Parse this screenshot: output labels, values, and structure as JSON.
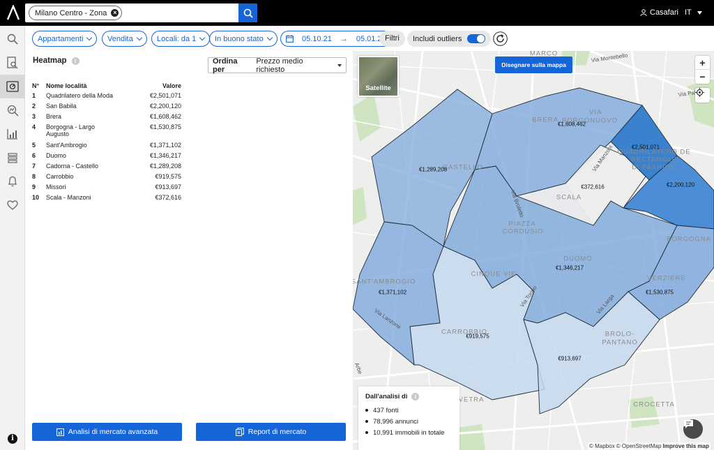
{
  "search": {
    "chip_label": "Milano Centro - Zona"
  },
  "header": {
    "user_name": "Casafari",
    "language": "IT"
  },
  "filters": {
    "property_type": "Appartamenti",
    "operation": "Vendita",
    "rooms": "Locali: da 1",
    "condition": "In buono stato",
    "date_from": "05.10.21",
    "date_arrow": "→",
    "date_to": "05.01.22",
    "more_label": "Filtri",
    "outliers_label": "Includi outliers",
    "outliers_on": true
  },
  "panel": {
    "title": "Heatmap",
    "sort_label": "Ordina per",
    "sort_value": "Prezzo medio richiesto",
    "table_headers": {
      "rank": "N°",
      "name": "Nome località",
      "value": "Valore"
    },
    "rows": [
      {
        "rank": "1",
        "name": "Quadrilatero della Moda",
        "value": "€2,501,071"
      },
      {
        "rank": "2",
        "name": "San Babila",
        "value": "€2,200,120"
      },
      {
        "rank": "3",
        "name": "Brera",
        "value": "€1,608,462"
      },
      {
        "rank": "4",
        "name": "Borgogna - Largo Augusto",
        "value": "€1,530,875"
      },
      {
        "rank": "5",
        "name": "Sant'Ambrogio",
        "value": "€1,371,102"
      },
      {
        "rank": "6",
        "name": "Duomo",
        "value": "€1,346,217"
      },
      {
        "rank": "7",
        "name": "Cadorna - Castello",
        "value": "€1,289,208"
      },
      {
        "rank": "8",
        "name": "Carrobbio",
        "value": "€919,575"
      },
      {
        "rank": "9",
        "name": "Missori",
        "value": "€913,697"
      },
      {
        "rank": "10",
        "name": "Scala - Manzoni",
        "value": "€372,616"
      }
    ],
    "btn_advanced": "Analisi di mercato avanzata",
    "btn_report": "Report di mercato"
  },
  "map": {
    "satellite_label": "Satellite",
    "draw_label": "Disegnare sulla mappa",
    "zoom_in": "+",
    "zoom_out": "−",
    "stats_title": "Dall'analisi di",
    "stats": [
      "437 fonti",
      "78,996 annunci",
      "10,991 immobili in totale"
    ],
    "attribution_1": "© Mapbox © OpenStreetMap",
    "attribution_2": "Improve this map",
    "district_labels": [
      "MARCO",
      "BRERA",
      "BORGONUOVO",
      "VIA",
      "CASTELLO",
      "SCALA",
      "PIAZZA",
      "CORDUSIO",
      "DUOMO",
      "CINQUE VIE",
      "SANT'AMBROGIO",
      "CARROBBIO",
      "BROLO-",
      "PANTANO",
      "VERZIERE",
      "BORGOGNA",
      "CROCETTA",
      "VETRA",
      "QUADRILATERO DE",
      "RECTANGLE",
      "DI FASHION"
    ],
    "street_labels": [
      "Via Montebello",
      "Via Palestro",
      "Via Manzoni",
      "Via Broletto",
      "Via Torino",
      "Via Larga",
      "Via Lanzone",
      "Arbe"
    ],
    "area_values": [
      "€2,501,071",
      "€2,200,120",
      "€1,608,462",
      "€1,530,875",
      "€1,371,102",
      "€1,346,217",
      "€1,289,208",
      "€919,575",
      "€913,697",
      "€372,616"
    ]
  },
  "colors": {
    "accent": "#1565d8",
    "topbar": "#000000",
    "level_high": "#2f7bcc",
    "level_mid": "#7fa9dc",
    "level_low": "#c4d8ef"
  }
}
